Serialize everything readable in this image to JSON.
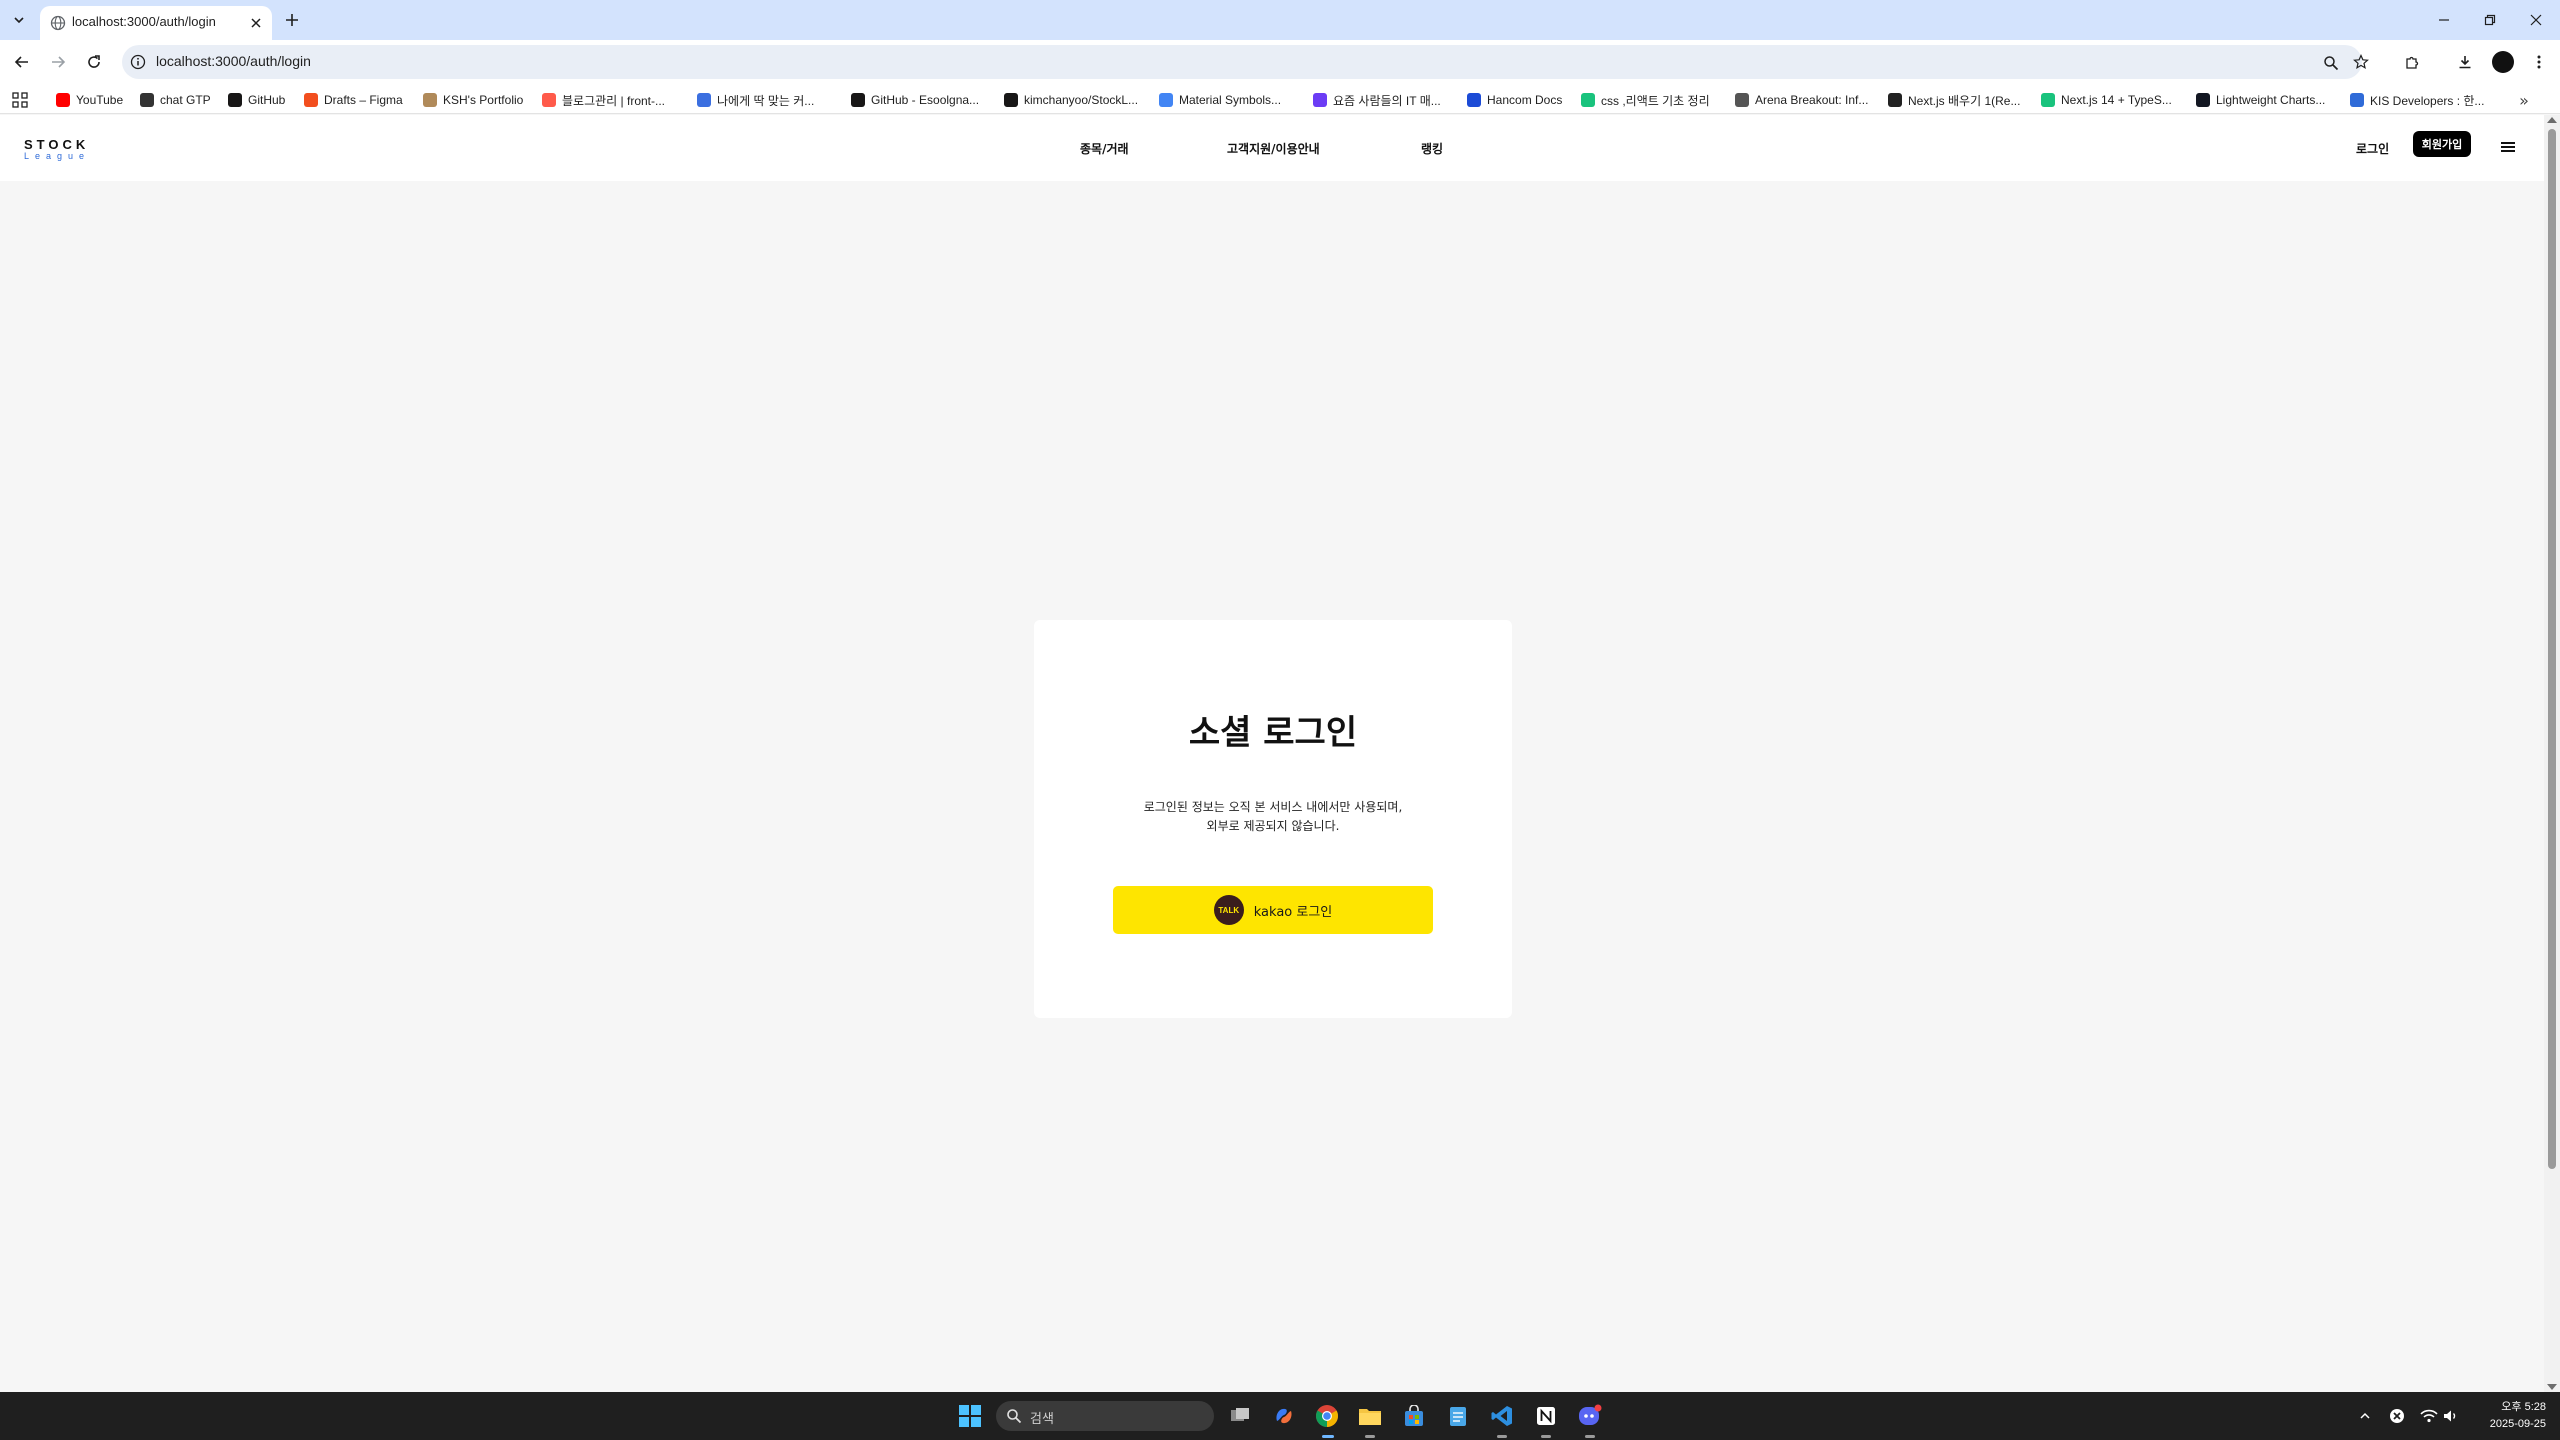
{
  "browser": {
    "tab_title": "localhost:3000/auth/login",
    "url": "localhost:3000/auth/login",
    "bookmarks": [
      {
        "label": "YouTube",
        "icon": "youtube-icon",
        "color": "#ff0000"
      },
      {
        "label": "chat GTP",
        "icon": "chatgpt-icon",
        "color": "#333333"
      },
      {
        "label": "GitHub",
        "icon": "github-icon",
        "color": "#181717"
      },
      {
        "label": "Drafts – Figma",
        "icon": "figma-icon",
        "color": "#f24e1e"
      },
      {
        "label": "KSH's Portfolio",
        "icon": "portfolio-icon",
        "color": "#b08a5a"
      },
      {
        "label": "블로그관리 | front-...",
        "icon": "blog-icon",
        "color": "#ff5a4a"
      },
      {
        "label": "나에게 딱 맞는 커...",
        "icon": "s-icon",
        "color": "#3b6fe0"
      },
      {
        "label": "GitHub - Esoolgna...",
        "icon": "github-icon",
        "color": "#181717"
      },
      {
        "label": "kimchanyoo/StockL...",
        "icon": "github-icon",
        "color": "#181717"
      },
      {
        "label": "Material Symbols...",
        "icon": "material-icon",
        "color": "#4285f4"
      },
      {
        "label": "요즘 사람들의 IT 매...",
        "icon": "yozm-icon",
        "color": "#6b3cf5"
      },
      {
        "label": "Hancom Docs",
        "icon": "hancom-icon",
        "color": "#1c4bd6"
      },
      {
        "label": "css ,리액트 기초 정리",
        "icon": "v-icon",
        "color": "#19c37d"
      },
      {
        "label": "Arena Breakout: Inf...",
        "icon": "arena-icon",
        "color": "#555555"
      },
      {
        "label": "Next.js 배우기 1(Re...",
        "icon": "next-icon",
        "color": "#222222"
      },
      {
        "label": "Next.js 14 + TypeS...",
        "icon": "v-icon",
        "color": "#19c37d"
      },
      {
        "label": "Lightweight Charts...",
        "icon": "tv-icon",
        "color": "#131722"
      },
      {
        "label": "KIS Developers : 한...",
        "icon": "kis-icon",
        "color": "#2f6bd8"
      }
    ]
  },
  "site": {
    "logo_top": "STOCK",
    "logo_bottom": "League",
    "nav": [
      "종목/거래",
      "고객지원/이용안내",
      "랭킹"
    ],
    "login": "로그인",
    "signup": "회원가입"
  },
  "card": {
    "title": "소셜 로그인",
    "desc_line1": "로그인된 정보는 오직 본 서비스 내에서만 사용되며,",
    "desc_line2": "외부로 제공되지 않습니다.",
    "kakao_icon_text": "TALK",
    "kakao_label": "kakao 로그인",
    "kakao_color": "#fee500"
  },
  "taskbar": {
    "search_placeholder": "검색",
    "time": "오후 5:28",
    "date": "2025-09-25"
  }
}
